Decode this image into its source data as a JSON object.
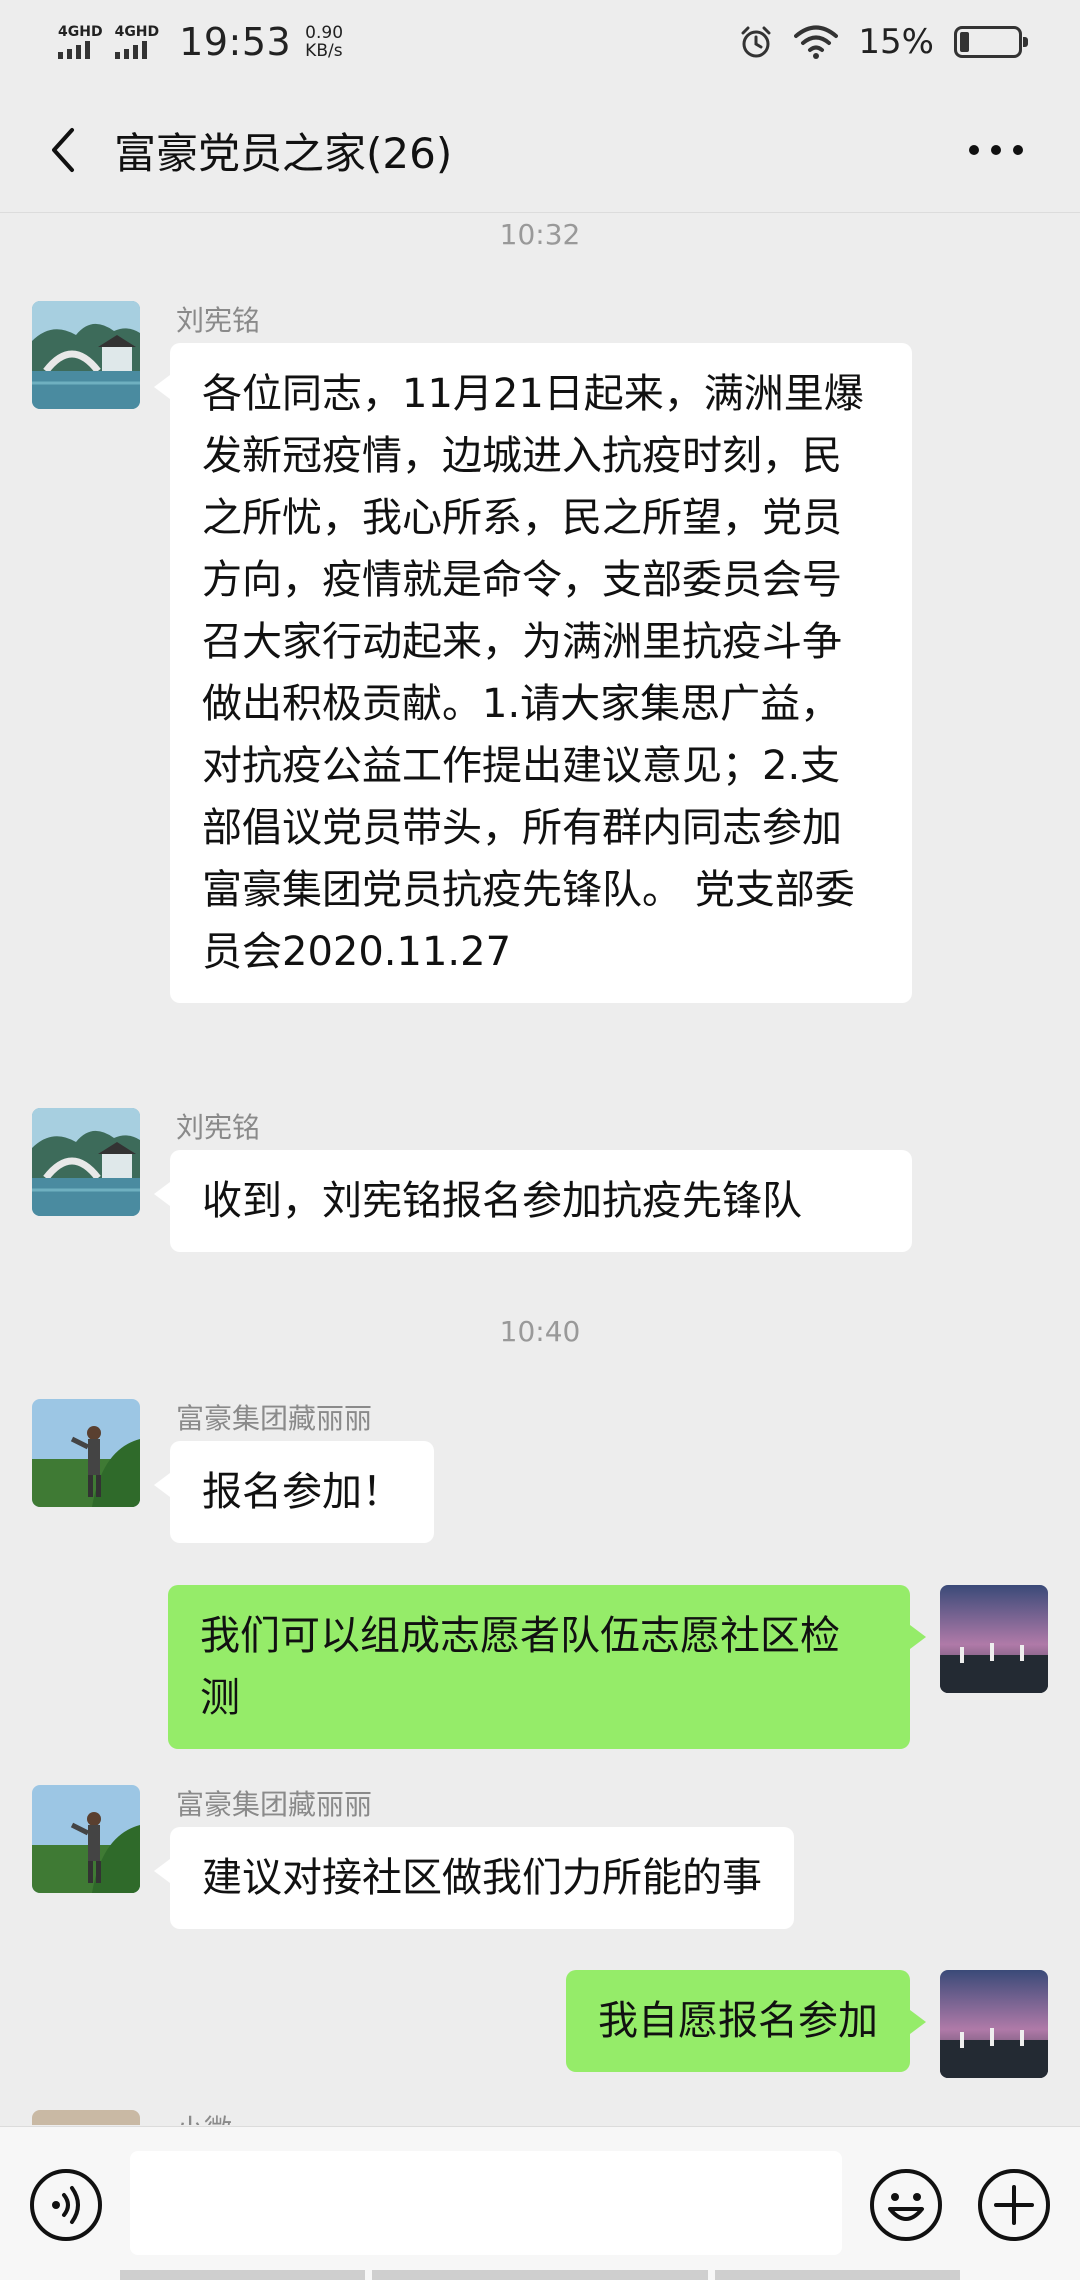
{
  "status_bar": {
    "signal1": "4GHD",
    "signal2": "4GHD",
    "time": "19:53",
    "speed_value": "0.90",
    "speed_unit": "KB/s",
    "battery_pct": "15%",
    "battery_level": 0.15
  },
  "header": {
    "title": "富豪党员之家(26)"
  },
  "timestamps": [
    "10:32",
    "10:40"
  ],
  "messages": [
    {
      "sender": "刘宪铭",
      "text": "各位同志，11月21日起来，满洲里爆发新冠疫情，边城进入抗疫时刻，民之所忧，我心所系，民之所望，党员方向，疫情就是命令，支部委员会号召大家行动起来，为满洲里抗疫斗争做出积极贡献。1.请大家集思广益，对抗疫公益工作提出建议意见；2.支部倡议党员带头，所有群内同志参加富豪集团党员抗疫先锋队。 党支部委员会2020.11.27"
    },
    {
      "sender": "刘宪铭",
      "text": "收到，刘宪铭报名参加抗疫先锋队"
    },
    {
      "sender": "富豪集团藏丽丽",
      "text": "报名参加！"
    },
    {
      "sender": "",
      "text": "我们可以组成志愿者队伍志愿社区检测"
    },
    {
      "sender": "富豪集团藏丽丽",
      "text": "建议对接社区做我们力所能的事"
    },
    {
      "sender": "",
      "text": "我自愿报名参加"
    },
    {
      "sender": "小微",
      "text": ""
    }
  ],
  "input": {
    "placeholder": ""
  },
  "icons": {
    "back": "chevron-left-icon",
    "more": "more-dots-icon",
    "voice": "voice-icon",
    "emoji": "emoji-icon",
    "plus": "plus-icon"
  }
}
